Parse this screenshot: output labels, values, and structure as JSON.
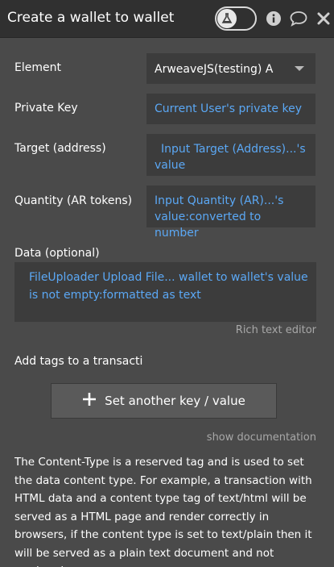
{
  "header": {
    "title": "Create a wallet to wallet"
  },
  "fields": {
    "element": {
      "label": "Element",
      "value": "ArweaveJS(testing) A"
    },
    "private_key": {
      "label": "Private Key",
      "value": "Current User's private key"
    },
    "target": {
      "label": "Target (address)",
      "value_line1": "Input Target (Address)...'s",
      "value_line2": "value"
    },
    "quantity": {
      "label": "Quantity (AR tokens)",
      "value_line1": "Input Quantity (AR)...'s",
      "value_line2": "value:converted to number"
    },
    "data": {
      "label": "Data (optional)",
      "value_line1": "FileUploader Upload File... wallet to wallet's value",
      "value_line2": "is not empty:formatted as text"
    }
  },
  "rich_text_editor_link": "Rich text editor",
  "tags": {
    "label": "Add tags to a transacti",
    "add_button": "Set another key / value"
  },
  "show_documentation_link": "show documentation",
  "documentation": "The Content-Type is a reserved tag and is used to set the data content type. For example, a transaction with HTML data and a content type tag of text/html will be served as a HTML page and render correctly in browsers, if the content type is set to text/plain then it will be served as a plain text document and not rendered."
}
